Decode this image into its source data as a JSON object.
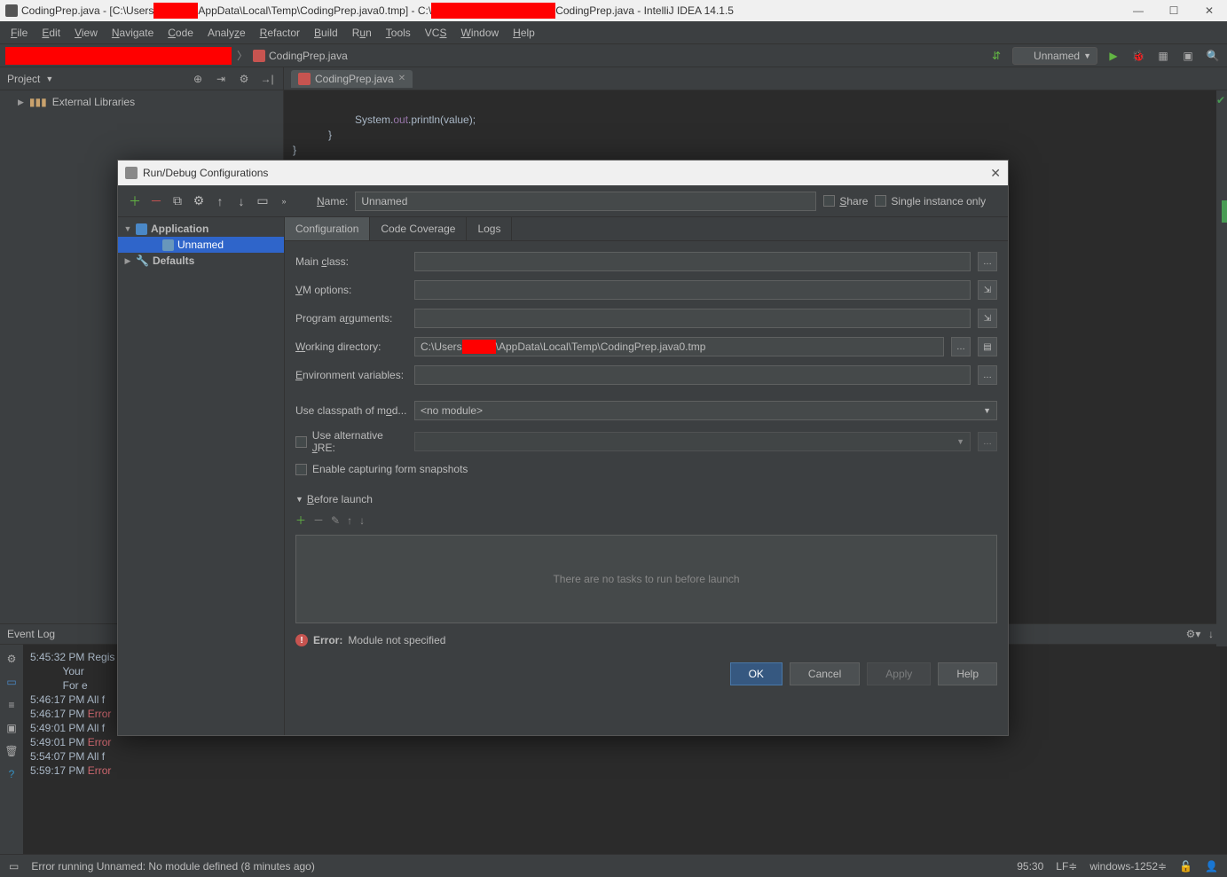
{
  "titlebar": {
    "pre": "CodingPrep.java - [C:\\Users",
    "mid": "AppData\\Local\\Temp\\CodingPrep.java0.tmp] - C:\\",
    "post": "CodingPrep.java - IntelliJ IDEA 14.1.5"
  },
  "menus": [
    "File",
    "Edit",
    "View",
    "Navigate",
    "Code",
    "Analyze",
    "Refactor",
    "Build",
    "Run",
    "Tools",
    "VCS",
    "Window",
    "Help"
  ],
  "navbar": {
    "crumb": "CodingPrep.java",
    "runconfig": "Unnamed"
  },
  "project": {
    "header": "Project",
    "external_libs": "External Libraries"
  },
  "editor": {
    "tab": "CodingPrep.java",
    "line1_a": "System.",
    "line1_b": "out",
    "line1_c": ".println(value);",
    "line2": "            }",
    "line3": "    }",
    "line4": "}"
  },
  "eventlog": {
    "title": "Event Log",
    "lines": [
      {
        "t": "5:45:32 PM",
        "m": "Regis"
      },
      {
        "t": "",
        "m": "Your "
      },
      {
        "t": "",
        "m": "For e"
      },
      {
        "t": "5:46:17 PM",
        "m": "All f"
      },
      {
        "t": "5:46:17 PM",
        "m": "Error",
        "err": true
      },
      {
        "t": "5:49:01 PM",
        "m": "All f"
      },
      {
        "t": "5:49:01 PM",
        "m": "Error",
        "err": true
      },
      {
        "t": "5:54:07 PM",
        "m": "All f"
      },
      {
        "t": "5:59:17 PM",
        "m": "Error",
        "err": true
      }
    ]
  },
  "statusbar": {
    "msg": "Error running Unnamed: No module defined (8 minutes ago)",
    "pos": "95:30",
    "lf": "LF≑",
    "enc": "windows-1252≑"
  },
  "dialog": {
    "title": "Run/Debug Configurations",
    "tree": {
      "app": "Application",
      "unnamed": "Unnamed",
      "defaults": "Defaults"
    },
    "name_lbl": "Name:",
    "name_val": "Unnamed",
    "share": "Share",
    "single": "Single instance only",
    "tabs": [
      "Configuration",
      "Code Coverage",
      "Logs"
    ],
    "form": {
      "main_class": "Main class:",
      "vm_options": "VM options:",
      "program_args": "Program arguments:",
      "working_dir": "Working directory:",
      "working_dir_val_a": "C:\\Users",
      "working_dir_val_b": "\\AppData\\Local\\Temp\\CodingPrep.java0.tmp",
      "env_vars": "Environment variables:",
      "classpath": "Use classpath of mod...",
      "no_module": "<no module>",
      "alt_jre": "Use alternative JRE:",
      "snapshots": "Enable capturing form snapshots"
    },
    "before_launch": {
      "label": "Before launch",
      "empty": "There are no tasks to run before launch"
    },
    "error": {
      "label": "Error:",
      "msg": "Module not specified"
    },
    "buttons": {
      "ok": "OK",
      "cancel": "Cancel",
      "apply": "Apply",
      "help": "Help"
    }
  }
}
